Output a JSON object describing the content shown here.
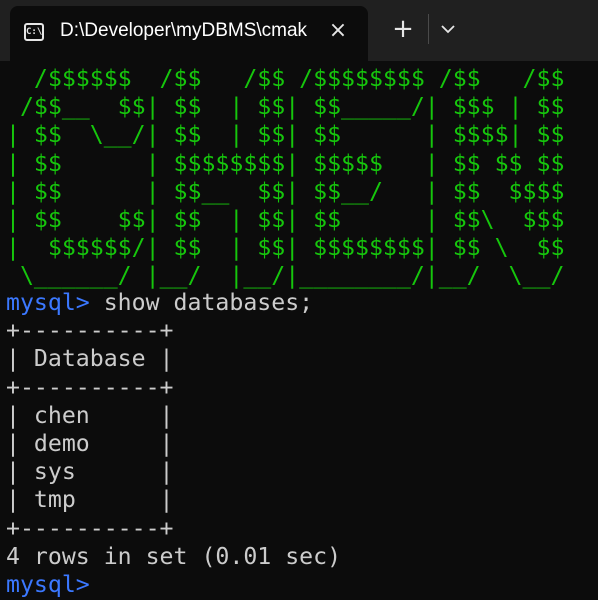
{
  "window": {
    "tab_title": "D:\\Developer\\myDBMS\\cmak",
    "tab_icon": "terminal-icon",
    "tab_icon_text": "C:\\",
    "close_icon": "×",
    "new_tab_icon": "+"
  },
  "terminal": {
    "banner_lines": [
      "  /$$$$$$  /$$   /$$ /$$$$$$$$ /$$   /$$",
      " /$$__  $$| $$  | $$| $$_____/| $$$ | $$",
      "| $$  \\__/| $$  | $$| $$      | $$$$| $$",
      "| $$      | $$$$$$$$| $$$$$   | $$ $$ $$",
      "| $$      | $$__  $$| $$__/   | $$  $$$$",
      "| $$    $$| $$  | $$| $$      | $$\\  $$$",
      "|  $$$$$$/| $$  | $$| $$$$$$$$| $$ \\  $$",
      " \\______/ |__/  |__/|________/|__/  \\__/"
    ],
    "prompt": "mysql>",
    "command": " show databases;",
    "table_border": "+----------+",
    "table_header": "| Database |",
    "rows": [
      "| chen     |",
      "| demo     |",
      "| sys      |",
      "| tmp      |"
    ],
    "result_summary": "4 rows in set (0.01 sec)",
    "colors": {
      "banner": "#16c60c",
      "prompt": "#3b78ff",
      "text": "#cccccc",
      "background": "#0c0c0c"
    }
  }
}
